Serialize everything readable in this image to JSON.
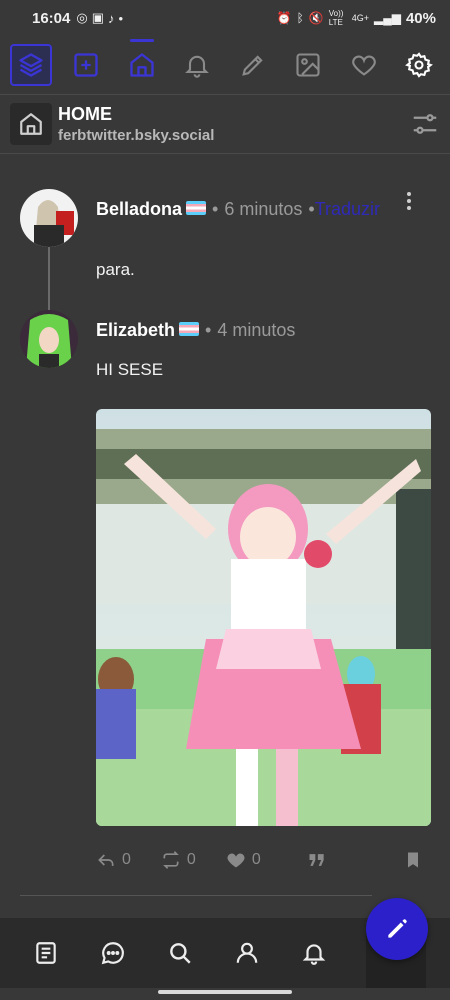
{
  "status_bar": {
    "time": "16:04",
    "battery": "40%",
    "network": "4G+",
    "volte": "Vo)) LTE"
  },
  "toolbar": {
    "icons": [
      "layers-icon",
      "add-box-icon",
      "home-icon",
      "bell-icon",
      "pencil-icon",
      "image-icon",
      "heart-icon",
      "settings-icon"
    ]
  },
  "header": {
    "title": "HOME",
    "subtitle": "ferbtwitter.bsky.social"
  },
  "posts": [
    {
      "author": "Belladona",
      "time": "6 minutos",
      "translate": "Traduzir",
      "text": "para."
    },
    {
      "author": "Elizabeth",
      "time": "4 minutos",
      "text": "HI SESE",
      "actions": {
        "replies": "0",
        "reposts": "0",
        "likes": "0"
      }
    }
  ],
  "separator": "•",
  "colors": {
    "accent": "#2b20c9",
    "background": "#383838",
    "link": "#2f2ab8"
  },
  "bottom_nav": {
    "icons": [
      "feed-icon",
      "chat-icon",
      "search-icon",
      "profile-icon",
      "bell-icon"
    ]
  }
}
